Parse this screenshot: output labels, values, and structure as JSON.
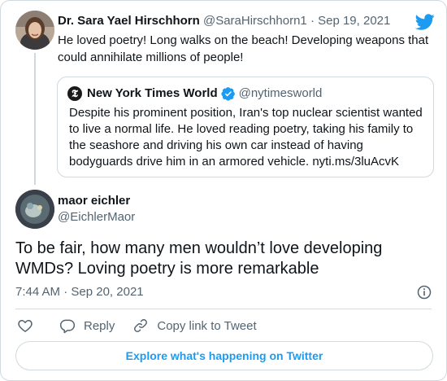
{
  "colors": {
    "brand": "#1d9bf0",
    "text": "#0f1419",
    "muted": "#536471",
    "border": "#cfd9de"
  },
  "tweet1": {
    "author_name": "Dr. Sara Yael Hirschhorn",
    "handle": "@SaraHirschhorn1",
    "separator": "·",
    "date": "Sep 19, 2021",
    "text": "He loved poetry!  Long walks on the beach! Developing weapons that could annihilate millions of people!",
    "quoted": {
      "author_name": "New York Times World",
      "handle": "@nytimesworld",
      "text": "Despite his prominent position, Iran's top nuclear scientist wanted to live a normal life. He loved reading  poetry, taking his family to the seashore and driving his own car instead of having bodyguards drive him in an armored vehicle.  nyti.ms/3luAcvK",
      "avatar_icon": "nyt-logo-icon"
    }
  },
  "tweet2": {
    "author_name": "maor eichler",
    "handle": "@EichlerMaor",
    "text": "To be fair, how many men wouldn’t love developing WMDs? Loving poetry is more remarkable",
    "time": "7:44 AM",
    "separator": "·",
    "date": "Sep 20, 2021"
  },
  "actions": {
    "like_icon": "heart-icon",
    "reply_label": "Reply",
    "copy_label": "Copy link to Tweet"
  },
  "explore_label": "Explore what's happening on Twitter"
}
